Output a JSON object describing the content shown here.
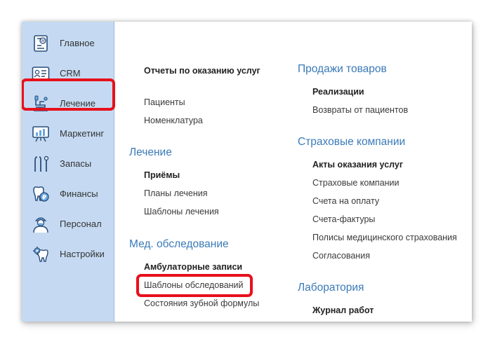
{
  "sidebar": {
    "items": [
      {
        "label": "Главное",
        "icon": "tooth-document-icon"
      },
      {
        "label": "CRM",
        "icon": "id-card-icon"
      },
      {
        "label": "Лечение",
        "icon": "dental-chair-icon"
      },
      {
        "label": "Маркетинг",
        "icon": "chart-board-icon"
      },
      {
        "label": "Запасы",
        "icon": "dental-tools-icon"
      },
      {
        "label": "Финансы",
        "icon": "tooth-coin-icon"
      },
      {
        "label": "Персонал",
        "icon": "doctor-icon"
      },
      {
        "label": "Настройки",
        "icon": "tooth-gear-icon"
      }
    ]
  },
  "content": {
    "col1": {
      "top": {
        "bold_link": "Отчеты по оказанию услуг",
        "links": [
          "Пациенты",
          "Номенклатура"
        ]
      },
      "treatment": {
        "heading": "Лечение",
        "bold_link": "Приёмы",
        "links": [
          "Планы лечения",
          "Шаблоны лечения"
        ]
      },
      "exam": {
        "heading": "Мед. обследование",
        "bold_link": "Амбулаторные записи",
        "links": [
          "Шаблоны обследований",
          "Состояния зубной формулы"
        ]
      }
    },
    "col2": {
      "sales": {
        "heading": "Продажи товаров",
        "bold_link": "Реализации",
        "links": [
          "Возвраты от пациентов"
        ]
      },
      "insurance": {
        "heading": "Страховые компании",
        "bold_link": "Акты оказания услуг",
        "links": [
          "Страховые компании",
          "Счета на оплату",
          "Счета-фактуры",
          "Полисы медицинского страхования",
          "Согласования"
        ]
      },
      "lab": {
        "heading": "Лаборатория",
        "bold_link": "Журнал работ"
      }
    }
  },
  "colors": {
    "sidebar_bg": "#c5daf2",
    "heading": "#3a7ab8",
    "highlight": "#e8101c"
  }
}
